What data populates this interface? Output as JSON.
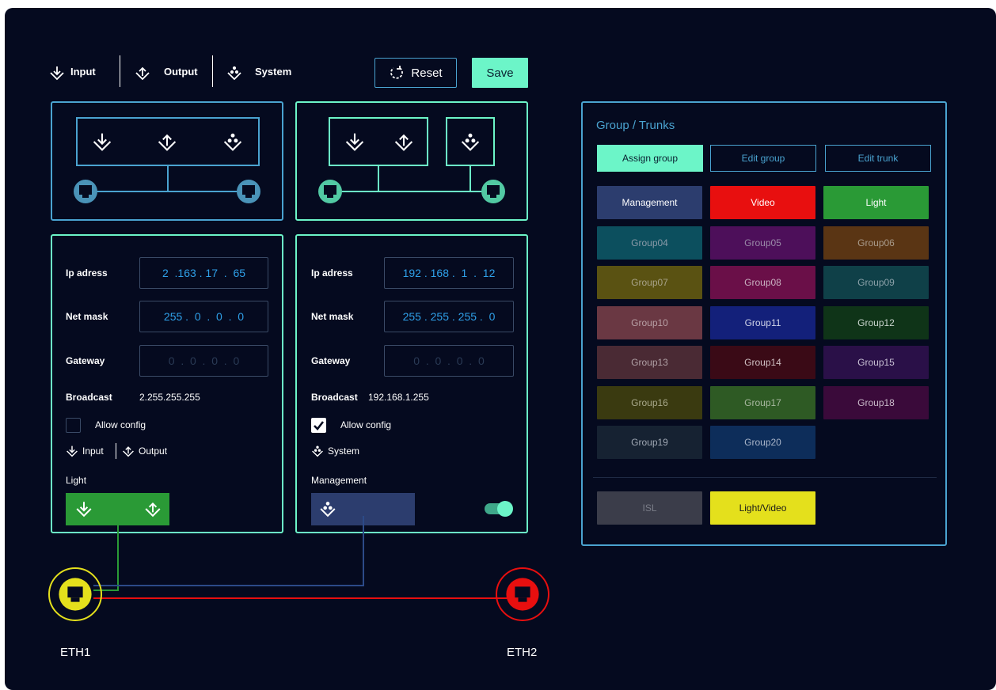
{
  "tabs": [
    {
      "label": "Input",
      "icon": "input-icon"
    },
    {
      "label": "Output",
      "icon": "output-icon"
    },
    {
      "label": "System",
      "icon": "system-icon"
    }
  ],
  "toolbar": {
    "reset_label": "Reset",
    "save_label": "Save"
  },
  "left_port": {
    "ip": "2  .163 . 17  .  65",
    "mask": "255 .  0  .  0  .  0",
    "gateway": "0  .  0  .  0  .  0",
    "broadcast": "2.255.255.255",
    "allow_config": false,
    "modes_input": "Input",
    "modes_output": "Output",
    "group_label": "Light",
    "group_color": "#2a9a36"
  },
  "right_port": {
    "ip": "192 . 168 .  1  .  12",
    "mask": "255 . 255 . 255 .  0",
    "gateway": "0  .  0  .  0  .  0",
    "broadcast": "192.168.1.255",
    "allow_config": true,
    "mode_system": "System",
    "group_label": "Management",
    "group_color": "#2c3d6e",
    "toggle_on": true
  },
  "labels": {
    "ip": "Ip adress",
    "mask": "Net mask",
    "gateway": "Gateway",
    "broadcast": "Broadcast",
    "allow_config": "Allow config"
  },
  "groups_panel": {
    "title": "Group / Trunks",
    "assign_label": "Assign group",
    "edit_group_label": "Edit group",
    "edit_trunk_label": "Edit trunk",
    "groups": [
      {
        "name": "Management",
        "bg": "#2c3d6e",
        "fg": "#ffffff"
      },
      {
        "name": "Video",
        "bg": "#e80f0f",
        "fg": "#ffffff"
      },
      {
        "name": "Light",
        "bg": "#2a9a36",
        "fg": "#ffffff"
      },
      {
        "name": "Group04",
        "bg": "#0c4f5e",
        "fg": "#8a9aa8"
      },
      {
        "name": "Group05",
        "bg": "#4d0f5a",
        "fg": "#9a8aa8"
      },
      {
        "name": "Group06",
        "bg": "#5a3514",
        "fg": "#a89a8a"
      },
      {
        "name": "Group07",
        "bg": "#5a5212",
        "fg": "#a8a38a"
      },
      {
        "name": "Group08",
        "bg": "#6a0f48",
        "fg": "#c8b0c0"
      },
      {
        "name": "Group09",
        "bg": "#0f4048",
        "fg": "#8aa0a8"
      },
      {
        "name": "Group10",
        "bg": "#6a3843",
        "fg": "#b8a0a5"
      },
      {
        "name": "Group11",
        "bg": "#13207a",
        "fg": "#d0d4e8"
      },
      {
        "name": "Group12",
        "bg": "#0f3418",
        "fg": "#c8d4cc"
      },
      {
        "name": "Group13",
        "bg": "#4a2a34",
        "fg": "#b0a0a5"
      },
      {
        "name": "Group14",
        "bg": "#3a0a16",
        "fg": "#d0c0c4"
      },
      {
        "name": "Group15",
        "bg": "#2a1048",
        "fg": "#c8c0d4"
      },
      {
        "name": "Group16",
        "bg": "#3a3a10",
        "fg": "#a8a88a"
      },
      {
        "name": "Group17",
        "bg": "#2e5a24",
        "fg": "#a8b8a0"
      },
      {
        "name": "Group18",
        "bg": "#3a0a3a",
        "fg": "#c8b8c8"
      },
      {
        "name": "Group19",
        "bg": "#162232",
        "fg": "#a0a8b4"
      },
      {
        "name": "Group20",
        "bg": "#0d2d5a",
        "fg": "#a8b4c8"
      }
    ],
    "trunks": [
      {
        "name": "ISL",
        "bg": "#3b3d4a",
        "fg": "#7a7d88"
      },
      {
        "name": "Light/Video",
        "bg": "#e4e01c",
        "fg": "#1a1a1a"
      }
    ]
  },
  "eth": {
    "eth1_label": "ETH1",
    "eth2_label": "ETH2"
  },
  "colors": {
    "background": "#050a1f",
    "accent_mint": "#6cf5c8",
    "panel_blue": "#4aa3d0",
    "eth1_ring": "#e4e01c",
    "eth2_ring": "#e80f0f"
  }
}
